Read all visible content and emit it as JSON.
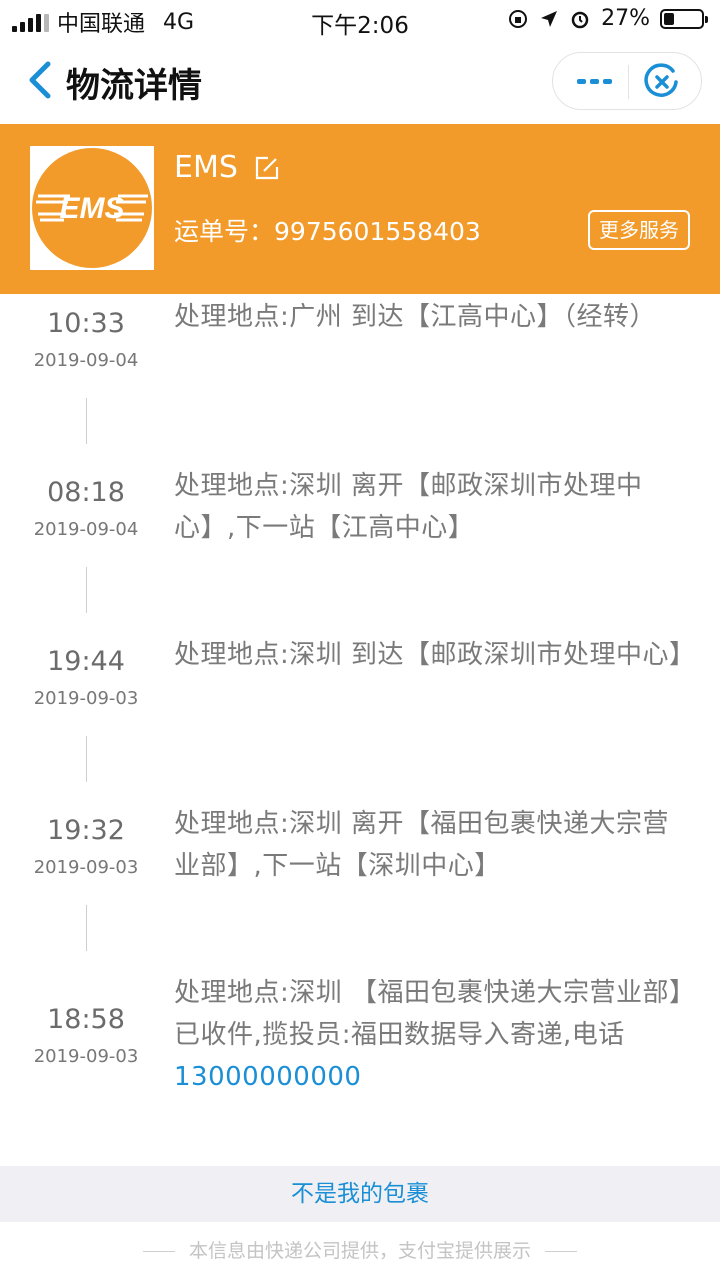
{
  "status_bar": {
    "carrier": "中国联通",
    "network": "4G",
    "time": "下午2:06",
    "battery": "27%",
    "battery_level": 0.27
  },
  "nav": {
    "title": "物流详情"
  },
  "header": {
    "company": "EMS",
    "logo_text": "EMS",
    "waybill_label": "运单号：",
    "waybill_number": "9975601558403",
    "more_services": "更多服务",
    "bg_color": "#f29b2b"
  },
  "events": [
    {
      "time": "10:33",
      "date": "2019-09-04",
      "text": "处理地点:广州 到达【江高中心】（经转）",
      "phone": ""
    },
    {
      "time": "08:18",
      "date": "2019-09-04",
      "text": "处理地点:深圳 离开【邮政深圳市处理中心】,下一站【江高中心】",
      "phone": ""
    },
    {
      "time": "19:44",
      "date": "2019-09-03",
      "text": "处理地点:深圳 到达【邮政深圳市处理中心】",
      "phone": ""
    },
    {
      "time": "19:32",
      "date": "2019-09-03",
      "text": "处理地点:深圳 离开【福田包裹快递大宗营业部】,下一站【深圳中心】",
      "phone": ""
    },
    {
      "time": "18:58",
      "date": "2019-09-03",
      "text": "处理地点:深圳 【福田包裹快递大宗营业部】已收件,揽投员:福田数据导入寄递,电话",
      "phone": "13000000000"
    }
  ],
  "not_mine": "不是我的包裹",
  "footer": "本信息由快递公司提供，支付宝提供展示",
  "colors": {
    "accent_blue": "#1a8fd6",
    "orange": "#f29b2b"
  }
}
